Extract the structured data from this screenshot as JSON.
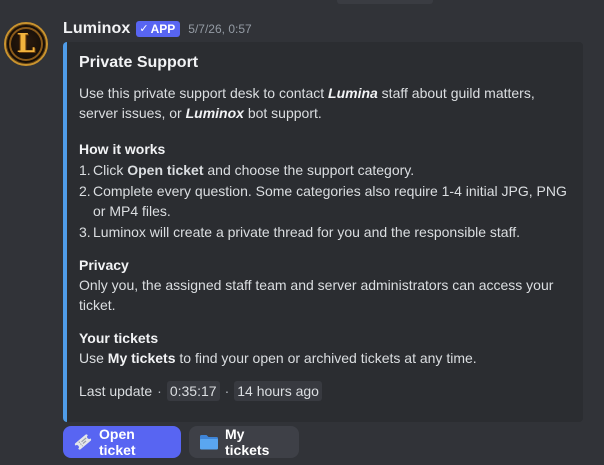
{
  "message": {
    "author": "Luminox",
    "avatar_letter": "L",
    "badge": {
      "check": "✓",
      "label": "APP"
    },
    "timestamp": "5/7/26, 0:57",
    "accent_color": "#4f9ce8"
  },
  "embed": {
    "title": "Private Support",
    "intro": {
      "p1": "Use this private support desk to contact ",
      "lumina": "Lumina",
      "p2": " staff about guild matters, server issues, or ",
      "luminox": "Luminox",
      "p3": " bot support."
    },
    "how": {
      "title": "How it works",
      "s1": {
        "num": "1.",
        "pre": "Click ",
        "bold": "Open ticket",
        "post": " and choose the support category."
      },
      "s2": {
        "num": "2.",
        "text": "Complete every question. Some categories also require 1-4 initial JPG, PNG or MP4 files."
      },
      "s3": {
        "num": "3.",
        "text": "Luminox will create a private thread for you and the responsible staff."
      }
    },
    "privacy": {
      "title": "Privacy",
      "text": "Only you, the assigned staff team and server administrators can access your ticket."
    },
    "tickets": {
      "title": "Your tickets",
      "pre": "Use ",
      "bold": "My tickets",
      "post": " to find your open or archived tickets at any time."
    },
    "footer": {
      "label": "Last update",
      "sep": "·",
      "time": "0:35:17",
      "relative": "14 hours ago"
    }
  },
  "buttons": {
    "open_ticket": {
      "label": "Open ticket",
      "icon": "ticket-icon"
    },
    "my_tickets": {
      "label": "My tickets",
      "icon": "folder-icon"
    }
  }
}
